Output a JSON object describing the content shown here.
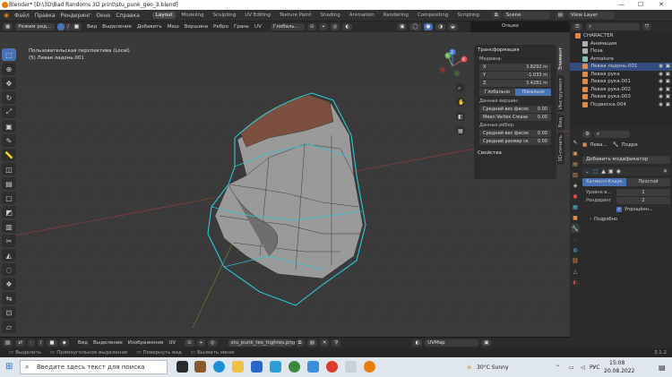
{
  "window": {
    "title": "Blender* [D:\\3D\\Bad Randoms 3D print\\stu_punk_geo_3.blend]",
    "minimize": "—",
    "maximize": "☐",
    "close": "✕"
  },
  "topmenu": {
    "items": [
      "Файл",
      "Правка",
      "Рендеринг",
      "Окно",
      "Справка"
    ],
    "workspaces": [
      "Layout",
      "Modeling",
      "Sculpting",
      "UV Editing",
      "Texture Paint",
      "Shading",
      "Animation",
      "Rendering",
      "Compositing",
      "Scripting"
    ],
    "active_workspace": "Layout",
    "scene": "Scene",
    "view_layer": "View Layer"
  },
  "viewport_header": {
    "mode": "Режим ред...",
    "menus": [
      "Вид",
      "Выделение",
      "Добавить",
      "Меш",
      "Вершина",
      "Ребро",
      "Грань",
      "UV"
    ],
    "orientation": "Глобаль...",
    "options": "Опции"
  },
  "viewport": {
    "perspective": "Пользовательская перспектива (Local)",
    "object": "(5) Левая ладонь.001",
    "gizmo": {
      "x": "X",
      "y": "Y",
      "z": "Z"
    }
  },
  "npanel": {
    "title": "Трансформация",
    "median_label": "Медиана:",
    "fields": [
      {
        "axis": "X",
        "value": "3.8292 m"
      },
      {
        "axis": "Y",
        "value": "-1.033 m"
      },
      {
        "axis": "Z",
        "value": "3.4281 m"
      }
    ],
    "seg": [
      "Глобально",
      "Локально"
    ],
    "vertex_data": "Данные вершин:",
    "mean_bevel": "Средний вес фасок",
    "mean_bevel_val": "0.00",
    "mean_crease": "Mean Vertex Crease",
    "mean_crease_val": "0.00",
    "edge_data": "Данные рёбер:",
    "edge_bevel": "Средний вес фасок",
    "edge_bevel_val": "0.00",
    "edge_seam": "Средний размер ск",
    "edge_seam_val": "0.00",
    "props": "Свойства",
    "tabs": [
      "Элемент",
      "Инструмент",
      "Вид",
      "3D-печать"
    ]
  },
  "outliner": {
    "items": [
      {
        "name": "CHARACTER",
        "indent": 0,
        "color": "#e08a4a",
        "sel": false
      },
      {
        "name": "Анимация",
        "indent": 1,
        "color": "#b0b0b0",
        "sel": false
      },
      {
        "name": "Поза",
        "indent": 1,
        "color": "#b0b0b0",
        "sel": false
      },
      {
        "name": "Armature",
        "indent": 1,
        "color": "#7ec0a8",
        "sel": false
      },
      {
        "name": "Левая ладонь.001",
        "indent": 1,
        "color": "#e08a4a",
        "sel": true
      },
      {
        "name": "Левая рука",
        "indent": 1,
        "color": "#e08a4a",
        "sel": false
      },
      {
        "name": "Левая рука.001",
        "indent": 1,
        "color": "#e08a4a",
        "sel": false
      },
      {
        "name": "Левая рука.002",
        "indent": 1,
        "color": "#e08a4a",
        "sel": false
      },
      {
        "name": "Левая рука.003",
        "indent": 1,
        "color": "#e08a4a",
        "sel": false
      },
      {
        "name": "Подвеска.004",
        "indent": 1,
        "color": "#e08a4a",
        "sel": false
      }
    ]
  },
  "properties": {
    "object": "Лева...",
    "modifier_name": "Подра",
    "add_modifier": "Добавить модификатор",
    "seg": [
      "Катмелл-Кларк",
      "Простой"
    ],
    "levels_label": "Уровни в...",
    "levels_val": "1",
    "render_label": "Рендеринг",
    "render_val": "2",
    "optimal": "Упрощённ...",
    "advanced": "Подробно"
  },
  "image_header": {
    "menus": [
      "Вид",
      "Выделение",
      "Изображение",
      "UV"
    ],
    "image": "stu_punk_tex_highres.png",
    "uvmap": "UVMap"
  },
  "statusbar": {
    "items": [
      "Выделить",
      "Прямоугольное выделение",
      "Повернуть вид",
      "Вызвать меню"
    ],
    "version": "3.1.2"
  },
  "taskbar": {
    "search": "Введите здесь текст для поиска",
    "weather": "30°C  Sunny",
    "lang": "РУС",
    "time": "15:08",
    "date": "20.08.2022"
  }
}
